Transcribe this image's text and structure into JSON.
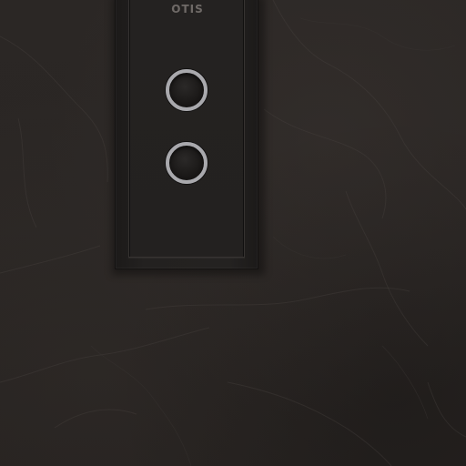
{
  "panel": {
    "brand": "OTIS",
    "buttons": [
      {
        "name": "up-call-button",
        "ring_color": "#a9a9ad"
      },
      {
        "name": "down-call-button",
        "ring_color": "#a9a9ad"
      }
    ]
  },
  "colors": {
    "wall": "#2a2624",
    "panel": "#232120",
    "brand_text": "#6f6a67",
    "button_ring": "#a9a9ad"
  }
}
